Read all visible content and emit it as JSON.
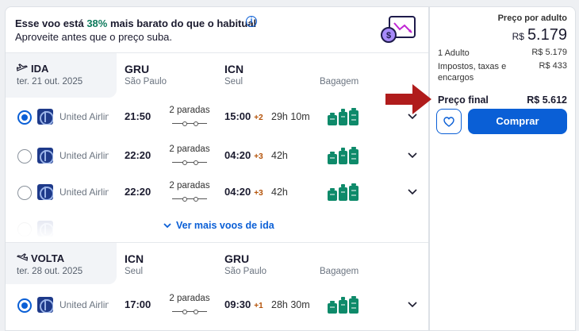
{
  "promo": {
    "text_before": "Esse voo está ",
    "percent": "38%",
    "text_after": " mais barato do que o habitual",
    "info_icon": "i",
    "subtitle": "Aproveite antes que o preço suba."
  },
  "outbound": {
    "title": "IDA",
    "date": "ter. 21 out. 2025",
    "from_code": "GRU",
    "from_city": "São Paulo",
    "to_code": "ICN",
    "to_city": "Seul",
    "bag_header": "Bagagem",
    "flights": [
      {
        "selected": true,
        "airline": "United Airlines",
        "dep": "21:50",
        "stops": "2 paradas",
        "arr": "15:00",
        "plus": "+2",
        "duration": "29h 10m"
      },
      {
        "selected": false,
        "airline": "United Airlines",
        "dep": "22:20",
        "stops": "2 paradas",
        "arr": "04:20",
        "plus": "+3",
        "duration": "42h"
      },
      {
        "selected": false,
        "airline": "United Airlines",
        "dep": "22:20",
        "stops": "2 paradas",
        "arr": "04:20",
        "plus": "+3",
        "duration": "42h"
      }
    ],
    "more_link": "Ver mais voos de ida"
  },
  "return": {
    "title": "VOLTA",
    "date": "ter. 28 out. 2025",
    "from_code": "ICN",
    "from_city": "Seul",
    "to_code": "GRU",
    "to_city": "São Paulo",
    "bag_header": "Bagagem",
    "flights": [
      {
        "selected": true,
        "airline": "United Airlines",
        "dep": "17:00",
        "stops": "2 paradas",
        "arr": "09:30",
        "plus": "+1",
        "duration": "28h 30m"
      }
    ]
  },
  "pricing": {
    "per_adult_label": "Preço por adulto",
    "currency": "R$",
    "per_adult_value": "5.179",
    "adult_label": "1 Adulto",
    "adult_value": "R$ 5.179",
    "taxes_label": "Impostos, taxas e encargos",
    "taxes_value": "R$ 433",
    "final_label": "Preço final",
    "final_value": "R$ 5.612",
    "buy_label": "Comprar"
  },
  "colors": {
    "accent": "#0a5fd6",
    "promo_green": "#0e7a5c",
    "bag_green": "#0e8a6a",
    "arrow_red": "#b01c1c"
  }
}
